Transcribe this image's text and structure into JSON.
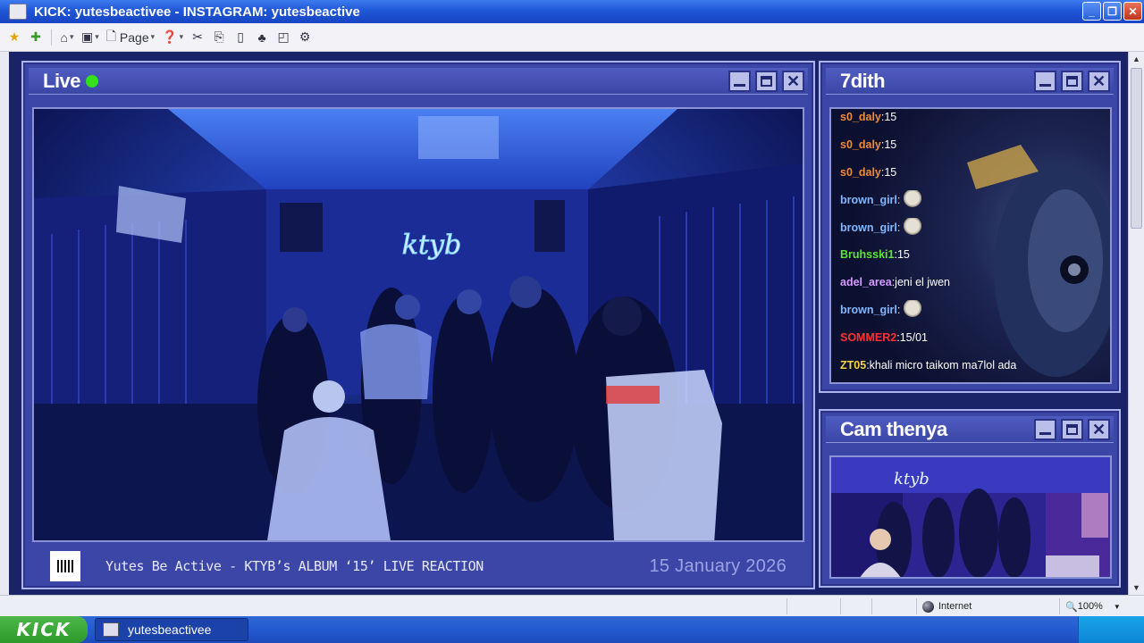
{
  "window": {
    "title": "KICK: yutesbeactivee -  INSTAGRAM: yutesbeactive",
    "buttons": {
      "minimize": "_",
      "maximize": "❐",
      "close": "✕"
    }
  },
  "commandbar": {
    "page_label": "Page"
  },
  "live_panel": {
    "title": "Live",
    "live_color": "#33e01b",
    "neon_sign": "ktyb",
    "caption": "Yutes Be Active - KTYB’s ALBUM ‘15’ LIVE REACTION",
    "date": "15 January 2026"
  },
  "chat_panel": {
    "title": "7dith",
    "messages": [
      {
        "user": "s0_daly",
        "color": "#f08a36",
        "text": " 15"
      },
      {
        "user": "s0_daly",
        "color": "#f08a36",
        "text": " 15"
      },
      {
        "user": "s0_daly",
        "color": "#f08a36",
        "text": " 15"
      },
      {
        "user": "brown_girl",
        "color": "#7fb7ff",
        "text": "",
        "emote": "seal-emote"
      },
      {
        "user": "brown_girl",
        "color": "#7fb7ff",
        "text": "",
        "emote": "seal-emote"
      },
      {
        "user": "Bruhsski1",
        "color": "#59e637",
        "text": " 15"
      },
      {
        "user": "adel_area",
        "color": "#d69cff",
        "text": " jeni el jwen"
      },
      {
        "user": "brown_girl",
        "color": "#7fb7ff",
        "text": "",
        "emote": "seal-emote"
      },
      {
        "user": "SOMMER2",
        "color": "#ff3030",
        "text": " 15/01"
      },
      {
        "user": "ZT05",
        "color": "#f6d33b",
        "text": " khali micro taikom ma7lol ada"
      }
    ]
  },
  "cam_panel": {
    "title": "Cam thenya"
  },
  "statusbar": {
    "zone": "Internet",
    "zoom": "100%"
  },
  "taskbar": {
    "start_label": "KICK",
    "task_label": "yutesbeactivee"
  }
}
